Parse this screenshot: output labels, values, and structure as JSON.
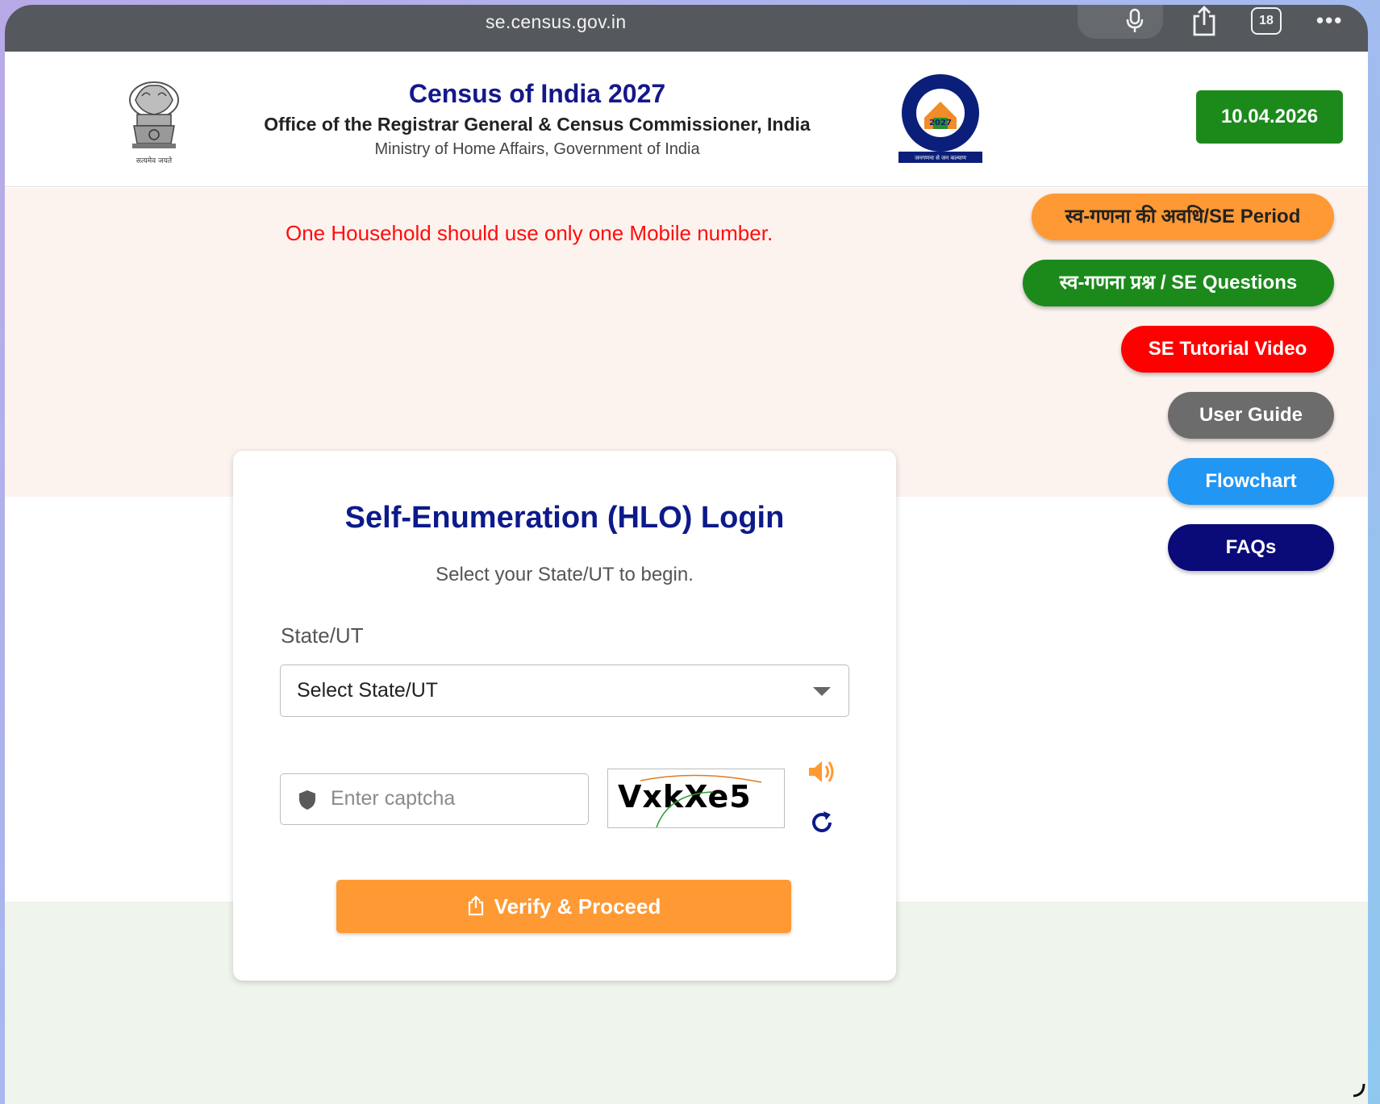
{
  "browser": {
    "url": "se.census.gov.in",
    "tab_count": "18",
    "icons": [
      "mic-icon",
      "share-icon",
      "tabs-icon",
      "more-icon"
    ]
  },
  "header": {
    "title": "Census of India 2027",
    "subtitle": "Office of the Registrar General & Census Commissioner, India",
    "ministry": "Ministry of Home Affairs, Government of India",
    "emblem_motto": "सत्यमेव जयते",
    "census_logo_text": "2027",
    "census_logo_ring": "भारत की जनगणना · CENSUS OF INDIA",
    "census_logo_tagline": "जनगणना से जन कल्याण",
    "date": "10.04.2026"
  },
  "notice": "One Household should use only one Mobile number.",
  "side_buttons": [
    {
      "label": "स्व-गणना की अवधि/SE Period",
      "color": "#ff9933"
    },
    {
      "label": "स्व-गणना प्रश्न / SE Questions",
      "color": "#1b8a1b"
    },
    {
      "label": "SE Tutorial Video",
      "color": "#ff0000"
    },
    {
      "label": "User Guide",
      "color": "#6c6c6c"
    },
    {
      "label": "Flowchart",
      "color": "#2196f3"
    },
    {
      "label": "FAQs",
      "color": "#0a0a78"
    }
  ],
  "login": {
    "title": "Self-Enumeration (HLO) Login",
    "subtitle": "Select your State/UT to begin.",
    "state_label": "State/UT",
    "state_select_value": "Select State/UT",
    "captcha_placeholder": "Enter captcha",
    "captcha_text": "VxkXe5",
    "verify_label": "Verify & Proceed"
  },
  "colors": {
    "primary_navy": "#0d1a8a",
    "saffron": "#ff9933",
    "green": "#1b8a1b",
    "notice_red": "#ff0d0d"
  }
}
